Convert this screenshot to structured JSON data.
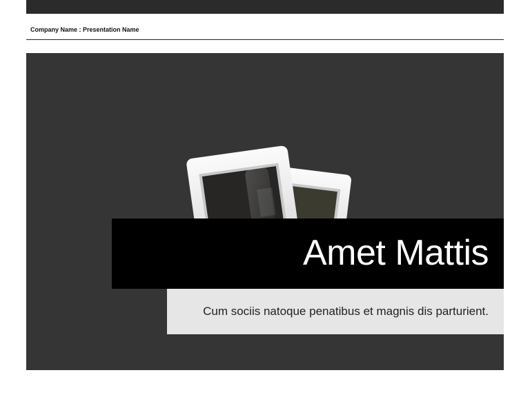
{
  "header": {
    "label": "Company Name : Presentation Name"
  },
  "slide": {
    "title": "Amet Mattis",
    "subtitle": "Cum sociis natoque penatibus et magnis dis parturient."
  },
  "icons": {
    "slides_art": "photo-slides-icon"
  },
  "colors": {
    "top_bar": "#2b2b2b",
    "slide_background": "#353535",
    "title_band": "#000000",
    "title_text": "#ffffff",
    "subtitle_band": "#e6e6e6",
    "subtitle_text": "#222222"
  }
}
